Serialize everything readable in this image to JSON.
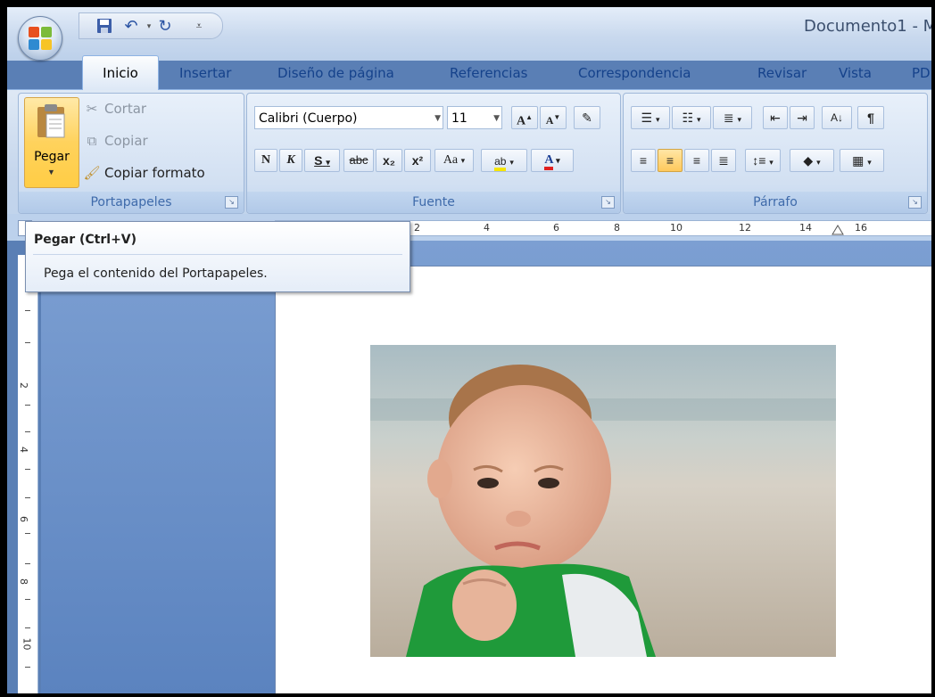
{
  "window": {
    "title": "Documento1 - M"
  },
  "quick_access": {
    "icons": [
      "save-icon",
      "undo-icon",
      "redo-icon",
      "customize-icon"
    ]
  },
  "tabs": [
    {
      "label": "Inicio",
      "active": true
    },
    {
      "label": "Insertar"
    },
    {
      "label": "Diseño de página"
    },
    {
      "label": "Referencias"
    },
    {
      "label": "Correspondencia"
    },
    {
      "label": "Revisar"
    },
    {
      "label": "Vista"
    },
    {
      "label": "PD"
    }
  ],
  "clipboard": {
    "paste_label": "Pegar",
    "cut_label": "Cortar",
    "copy_label": "Copiar",
    "format_painter_label": "Copiar formato",
    "group_label": "Portapapeles"
  },
  "font": {
    "family_value": "Calibri (Cuerpo)",
    "size_value": "11",
    "group_label": "Fuente",
    "bold_glyph": "N",
    "italic_glyph": "K",
    "underline_glyph": "S",
    "strike_glyph": "abc",
    "subscript_glyph": "x₂",
    "superscript_glyph": "x²",
    "case_glyph": "Aa",
    "highlight_glyph": "ab",
    "color_glyph": "A"
  },
  "paragraph": {
    "group_label": "Párrafo",
    "pilcrow_glyph": "¶",
    "active_alignment": "center"
  },
  "ruler": {
    "h_numbers": [
      "2",
      "4",
      "6",
      "8",
      "10",
      "12",
      "14",
      "16"
    ],
    "v_numbers": [
      "2",
      "4",
      "6",
      "8",
      "10"
    ]
  },
  "tooltip": {
    "title": "Pegar (Ctrl+V)",
    "body": "Pega el contenido del Portapapeles."
  },
  "colors": {
    "tab_text": "#15428b",
    "ribbon": "#c4d5ec",
    "workspace": "#5b83bf",
    "paste_highlight": "#ffd25c"
  }
}
